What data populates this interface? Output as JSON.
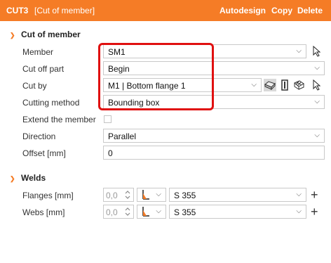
{
  "titlebar": {
    "id": "CUT3",
    "name": "[Cut of member]",
    "actions": [
      "Autodesign",
      "Copy",
      "Delete"
    ]
  },
  "cut_section": {
    "title": "Cut of member",
    "member": {
      "label": "Member",
      "value": "SM1"
    },
    "cut_off_part": {
      "label": "Cut off part",
      "value": "Begin"
    },
    "cut_by": {
      "label": "Cut by",
      "value": "M1 | Bottom flange 1"
    },
    "cutting_method": {
      "label": "Cutting method",
      "value": "Bounding box"
    },
    "extend_member": {
      "label": "Extend the member",
      "checked": false
    },
    "direction": {
      "label": "Direction",
      "value": "Parallel"
    },
    "offset": {
      "label": "Offset [mm]",
      "value": "0"
    }
  },
  "welds_section": {
    "title": "Welds",
    "flanges": {
      "label": "Flanges [mm]",
      "size": "0,0",
      "material": "S 355"
    },
    "webs": {
      "label": "Webs [mm]",
      "size": "0,0",
      "material": "S 355"
    }
  }
}
